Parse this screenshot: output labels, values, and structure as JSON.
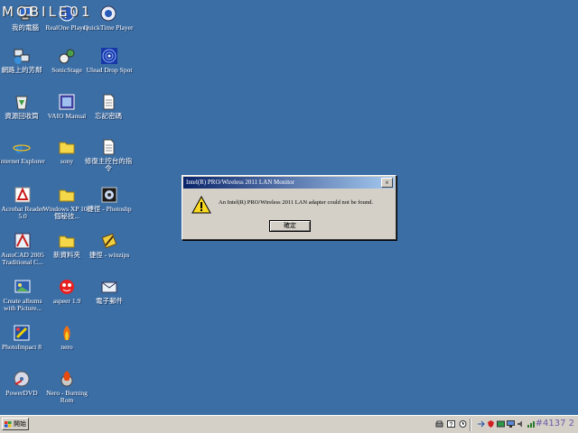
{
  "watermark": {
    "text": "MOBILE01"
  },
  "desktop_icons": [
    {
      "label": "我的電腦"
    },
    {
      "label": "RealOne Player"
    },
    {
      "label": "QuickTime Player"
    },
    {
      "label": "網路上的芳鄰"
    },
    {
      "label": "SonicStage"
    },
    {
      "label": "Ulead Drop Spot"
    },
    {
      "label": "資源回收筒"
    },
    {
      "label": "VAIO Manual"
    },
    {
      "label": "忘記密碼"
    },
    {
      "label": "Internet Explorer"
    },
    {
      "label": "sony"
    },
    {
      "label": "修復主控台的指令"
    },
    {
      "label": "Acrobat Reader 5.0"
    },
    {
      "label": "Windows XP 108個秘技..."
    },
    {
      "label": "捷徑 - Photoshp"
    },
    {
      "label": "AutoCAD 2005 Traditional C..."
    },
    {
      "label": "新資料夾"
    },
    {
      "label": "捷徑 - winzips"
    },
    {
      "label": "Create albums with Picture..."
    },
    {
      "label": "aspeer 1.9"
    },
    {
      "label": "電子郵件"
    },
    {
      "label": "PhotoImpact 8"
    },
    {
      "label": "nero"
    },
    {
      "label": "PowerDVD"
    },
    {
      "label": "Nero - Burning Rom"
    }
  ],
  "dialog": {
    "title": "Intel(R) PRO/Wireless 2011 LAN Monitor",
    "close_glyph": "×",
    "message": "An Intel(R) PRO/Wireless 2011 LAN adapter could not be found.",
    "ok_label": "確定"
  },
  "taskbar": {
    "start_label": "開始",
    "post_id": "#4137 2"
  },
  "colors": {
    "desktop": "#3b6ea5",
    "title_bar": "#0a246a",
    "face": "#d4d0c8"
  }
}
